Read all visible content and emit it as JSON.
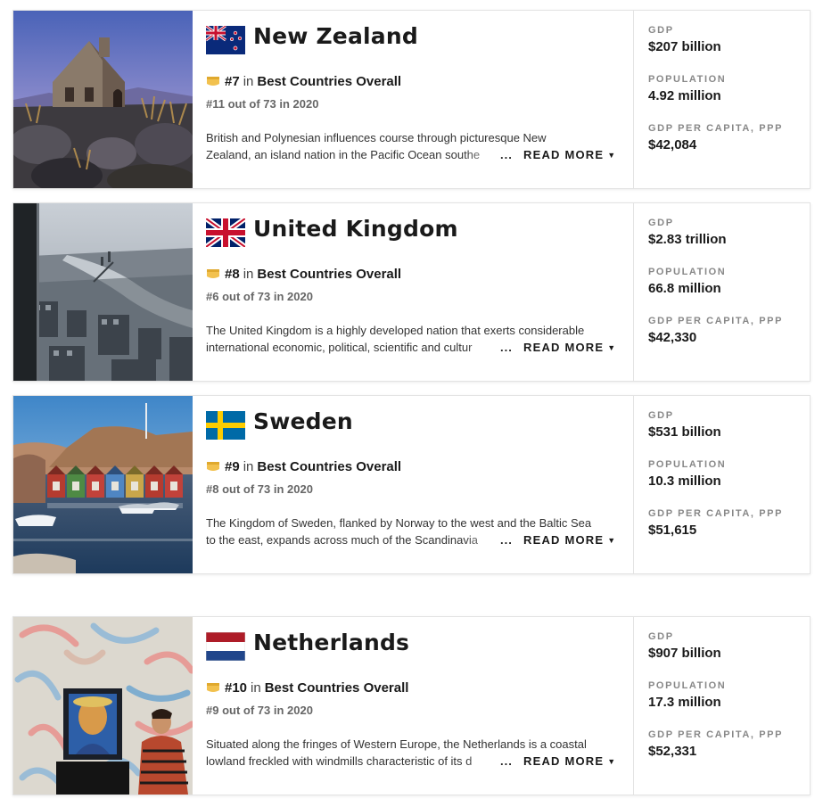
{
  "countries": [
    {
      "name": "New Zealand",
      "rank": "#7",
      "rank_in": "in",
      "list": "Best Countries Overall",
      "previous": "#11 out of 73 in 2020",
      "desc_line1": "British and Polynesian influences course through picturesque New",
      "desc_line2": "Zealand, an island nation in the Pacific Ocean southe",
      "ellipsis": "...",
      "read_more": "READ MORE",
      "gdp_label": "GDP",
      "gdp": "$207 billion",
      "pop_label": "POPULATION",
      "population": "4.92 million",
      "ppp_label": "GDP PER CAPITA, PPP",
      "gdp_ppp": "$42,084",
      "flag_icon": "new-zealand-flag",
      "photo": "church-on-rocky-shore-at-dusk"
    },
    {
      "name": "United Kingdom",
      "rank": "#8",
      "rank_in": "in",
      "list": "Best Countries Overall",
      "previous": "#6 out of 73 in 2020",
      "desc_line1": "The United Kingdom is a highly developed nation that exerts considerable",
      "desc_line2": "international economic, political, scientific and cultur",
      "ellipsis": "...",
      "read_more": "READ MORE",
      "gdp_label": "GDP",
      "gdp": "$2.83 trillion",
      "pop_label": "POPULATION",
      "population": "66.8 million",
      "ppp_label": "GDP PER CAPITA, PPP",
      "gdp_ppp": "$42,330",
      "flag_icon": "united-kingdom-flag",
      "photo": "aerial-city-river-view"
    },
    {
      "name": "Sweden",
      "rank": "#9",
      "rank_in": "in",
      "list": "Best Countries Overall",
      "previous": "#8 out of 73 in 2020",
      "desc_line1": "The Kingdom of Sweden, flanked by Norway to the west and the Baltic Sea",
      "desc_line2": "to the east, expands across much of the Scandinavia",
      "ellipsis": "...",
      "read_more": "READ MORE",
      "gdp_label": "GDP",
      "gdp": "$531 billion",
      "pop_label": "POPULATION",
      "population": "10.3 million",
      "ppp_label": "GDP PER CAPITA, PPP",
      "gdp_ppp": "$51,615",
      "flag_icon": "sweden-flag",
      "photo": "colorful-boathouses-harbor"
    },
    {
      "name": "Netherlands",
      "rank": "#10",
      "rank_in": "in",
      "list": "Best Countries Overall",
      "previous": "#9 out of 73 in 2020",
      "desc_line1": "Situated along the fringes of Western Europe, the Netherlands is a coastal",
      "desc_line2": "lowland freckled with windmills characteristic of its d",
      "ellipsis": "...",
      "read_more": "READ MORE",
      "gdp_label": "GDP",
      "gdp": "$907 billion",
      "pop_label": "POPULATION",
      "population": "17.3 million",
      "ppp_label": "GDP PER CAPITA, PPP",
      "gdp_ppp": "$52,331",
      "flag_icon": "netherlands-flag",
      "photo": "museum-painting-visitor"
    }
  ],
  "colors": {
    "medal": "#f2c14e",
    "border": "#e3e3e3",
    "label_gray": "#888888"
  },
  "icons": {
    "medal": "medal-icon",
    "chevron": "chevron-down-icon"
  }
}
